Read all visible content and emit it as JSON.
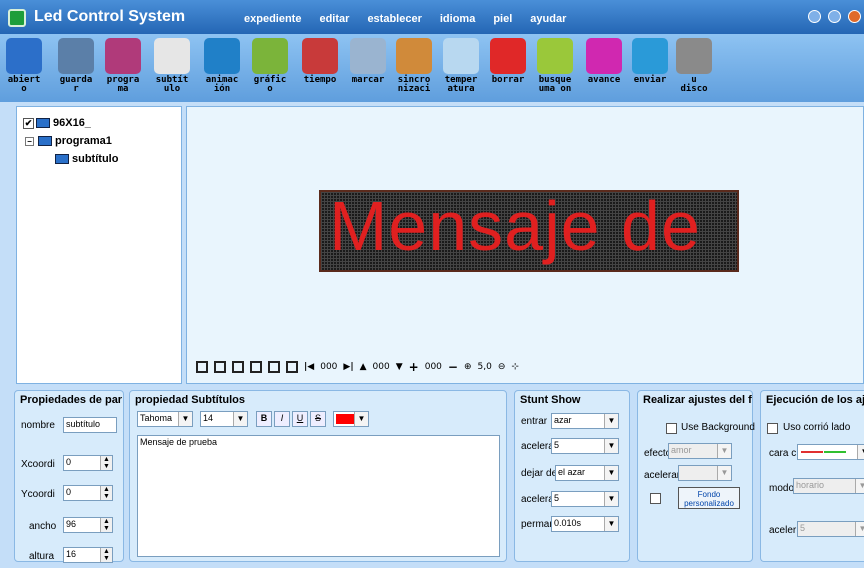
{
  "app": {
    "title": "Led Control System",
    "menu": [
      "expediente",
      "editar",
      "establecer",
      "idioma",
      "piel",
      "ayudar"
    ]
  },
  "toolbar": [
    {
      "icon": "folder-open-icon",
      "label_1": "abiert",
      "label_2": "o",
      "color": "#2c6fc9"
    },
    {
      "icon": "scanner-icon",
      "label_1": "guarda",
      "label_2": "r",
      "color": "#5b7fa8"
    },
    {
      "icon": "film-icon",
      "label_1": "progra",
      "label_2": "ma",
      "color": "#b03a7a"
    },
    {
      "icon": "paper-icon",
      "label_1": "subtít",
      "label_2": "ulo",
      "color": "#e6e6e6"
    },
    {
      "icon": "animation-icon",
      "label_1": "animac",
      "label_2": "ión",
      "color": "#2080c8"
    },
    {
      "icon": "image-icon",
      "label_1": "gráfic",
      "label_2": "o",
      "color": "#7bb43a"
    },
    {
      "icon": "calendar-icon",
      "label_1": "tiempo",
      "label_2": "",
      "color": "#c83a3a"
    },
    {
      "icon": "clock-icon",
      "label_1": "marcar",
      "label_2": "",
      "color": "#9ab4d0"
    },
    {
      "icon": "hourglass-icon",
      "label_1": "sincro",
      "label_2": "nizaci",
      "color": "#d08a3a"
    },
    {
      "icon": "cloud-icon",
      "label_1": "temper",
      "label_2": "atura",
      "color": "#b8d8f0"
    },
    {
      "icon": "delete-icon",
      "label_1": "borrar",
      "label_2": "",
      "color": "#e02828"
    },
    {
      "icon": "search-icon",
      "label_1": "busque",
      "label_2": "uma on",
      "color": "#9ac83a"
    },
    {
      "icon": "play-icon",
      "label_1": "avance",
      "label_2": "",
      "color": "#d028b0"
    },
    {
      "icon": "send-icon",
      "label_1": "enviar",
      "label_2": "",
      "color": "#2a9ad8"
    },
    {
      "icon": "usb-icon",
      "label_1": "u",
      "label_2": "disco",
      "color": "#8a8a8a"
    }
  ],
  "tree": {
    "root": "96X16_",
    "program": "programa1",
    "item": "subtítulo"
  },
  "preview": {
    "led_text": "Mensaje de",
    "alignment_values": [
      "000",
      "000"
    ],
    "zoom_value": "5,0"
  },
  "params_panel": {
    "title": "Propiedades de par",
    "name_label": "nombre",
    "name_value": "subtítulo",
    "x_label": "Xcoordi",
    "x_value": "0",
    "y_label": "Ycoordi",
    "y_value": "0",
    "width_label": "ancho",
    "width_value": "96",
    "height_label": "altura",
    "height_value": "16"
  },
  "subtitle_panel": {
    "title": "propiedad Subtítulos",
    "font_value": "Tahoma",
    "size_value": "14",
    "bold": "B",
    "italic": "I",
    "underline": "U",
    "strike": "S",
    "color": "#ff0000",
    "text": "Mensaje de prueba"
  },
  "stunt_panel": {
    "title": "Stunt Show",
    "enter_label": "entrar",
    "enter_value": "azar",
    "accel_label": "acelera",
    "accel_value": "5",
    "leave_label": "dejar de",
    "leave_value": "el azar",
    "accel2_label": "acelera",
    "accel2_value": "5",
    "stay_label": "perman",
    "stay_value": "0.010s"
  },
  "settings_panel": {
    "title": "Realizar ajustes del f",
    "use_bg_label": "Use Background",
    "effect_label": "efecto",
    "effect_value": "amor",
    "accel_label": "acelerar",
    "button_line1": "Fondo",
    "button_line2": "personalizado"
  },
  "exec_panel": {
    "title": "Ejecución de los aj",
    "side_label": "Uso corrió lado",
    "face_label": "cara c",
    "mode_label": "modo",
    "mode_value": "horario",
    "accel_label": "aceler",
    "accel_value": "5"
  }
}
